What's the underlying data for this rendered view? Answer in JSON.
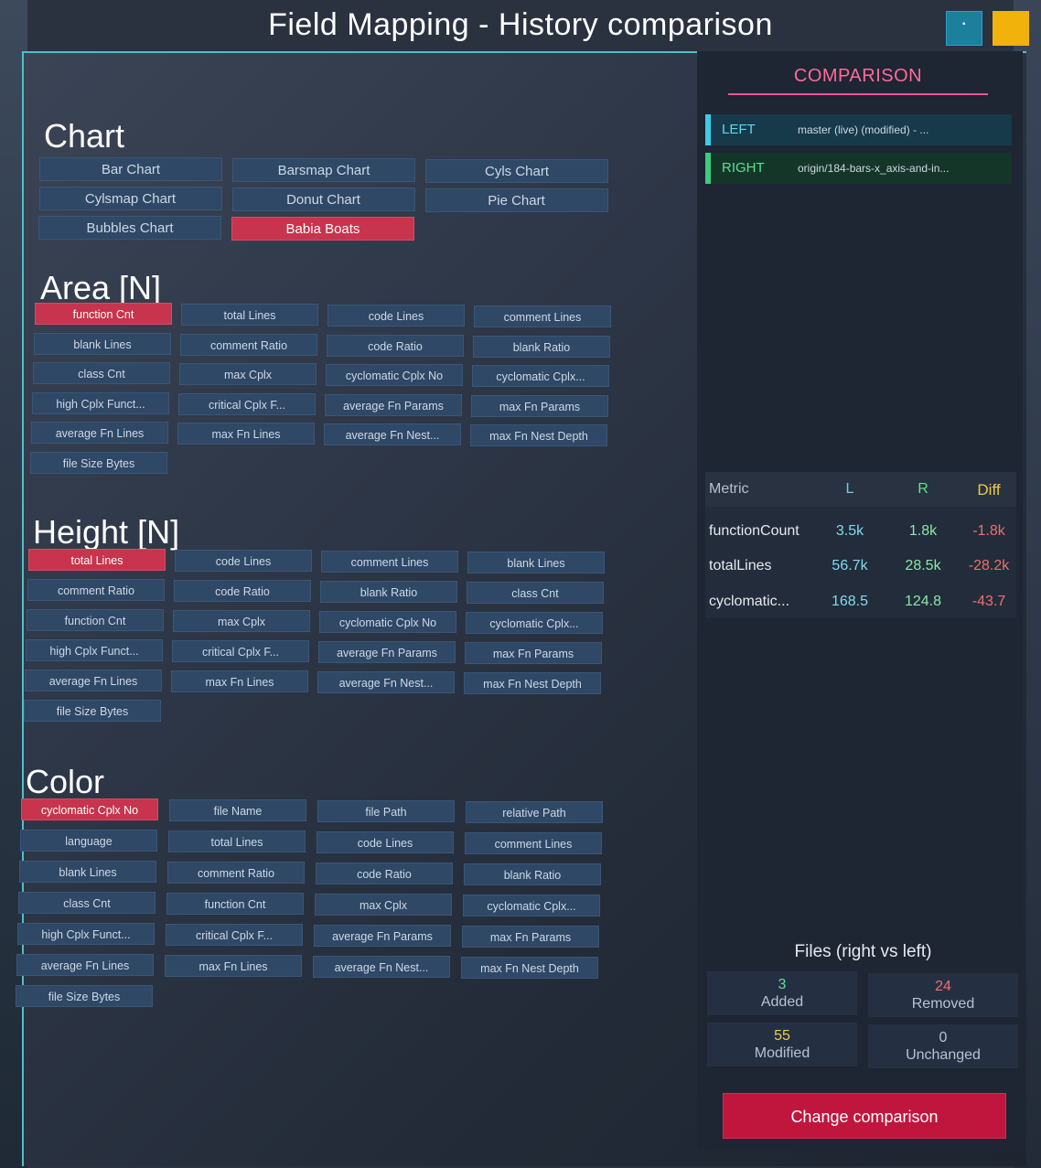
{
  "window": {
    "title": "Field Mapping - History comparison",
    "minimize_glyph": "▪"
  },
  "chart_section": {
    "title": "Chart",
    "buttons": [
      "Bar Chart",
      "Barsmap Chart",
      "Cyls Chart",
      "Cylsmap Chart",
      "Donut Chart",
      "Pie Chart",
      "Bubbles Chart",
      "Babia Boats"
    ],
    "selected": "Babia Boats"
  },
  "area_section": {
    "title": "Area [N]",
    "buttons": [
      "function Cnt",
      "total Lines",
      "code Lines",
      "comment Lines",
      "blank Lines",
      "comment Ratio",
      "code Ratio",
      "blank Ratio",
      "class Cnt",
      "max Cplx",
      "cyclomatic Cplx No",
      "cyclomatic Cplx...",
      "high Cplx Funct...",
      "critical Cplx F...",
      "average Fn Params",
      "max Fn Params",
      "average Fn Lines",
      "max Fn Lines",
      "average Fn Nest...",
      "max Fn Nest Depth",
      "file Size Bytes"
    ],
    "selected": "function Cnt"
  },
  "height_section": {
    "title": "Height [N]",
    "buttons": [
      "total Lines",
      "code Lines",
      "comment Lines",
      "blank Lines",
      "comment Ratio",
      "code Ratio",
      "blank Ratio",
      "class Cnt",
      "function Cnt",
      "max Cplx",
      "cyclomatic Cplx No",
      "cyclomatic Cplx...",
      "high Cplx Funct...",
      "critical Cplx F...",
      "average Fn Params",
      "max Fn Params",
      "average Fn Lines",
      "max Fn Lines",
      "average Fn Nest...",
      "max Fn Nest Depth",
      "file Size Bytes"
    ],
    "selected": "total Lines"
  },
  "color_section": {
    "title": "Color",
    "buttons": [
      "cyclomatic Cplx No",
      "file Name",
      "file Path",
      "relative Path",
      "language",
      "total Lines",
      "code Lines",
      "comment Lines",
      "blank Lines",
      "comment Ratio",
      "code Ratio",
      "blank Ratio",
      "class Cnt",
      "function Cnt",
      "max Cplx",
      "cyclomatic Cplx...",
      "high Cplx Funct...",
      "critical Cplx F...",
      "average Fn Params",
      "max Fn Params",
      "average Fn Lines",
      "max Fn Lines",
      "average Fn Nest...",
      "max Fn Nest Depth",
      "file Size Bytes"
    ],
    "selected": "cyclomatic Cplx No"
  },
  "comparison": {
    "title": "COMPARISON",
    "left": {
      "label": "LEFT",
      "value": "master (live) (modified) - ..."
    },
    "right": {
      "label": "RIGHT",
      "value": "origin/184-bars-x_axis-and-in..."
    }
  },
  "metrics_table": {
    "headers": {
      "metric": "Metric",
      "l": "L",
      "r": "R",
      "diff": "Diff"
    },
    "rows": [
      {
        "metric": "functionCount",
        "l": "3.5k",
        "r": "1.8k",
        "diff": "-1.8k"
      },
      {
        "metric": "totalLines",
        "l": "56.7k",
        "r": "28.5k",
        "diff": "-28.2k"
      },
      {
        "metric": "cyclomatic...",
        "l": "168.5",
        "r": "124.8",
        "diff": "-43.7"
      }
    ]
  },
  "files": {
    "title": "Files (right vs left)",
    "added": {
      "count": "3",
      "label": "Added",
      "color": "#5fe08f"
    },
    "removed": {
      "count": "24",
      "label": "Removed",
      "color": "#f06e6e"
    },
    "modified": {
      "count": "55",
      "label": "Modified",
      "color": "#f1c84b"
    },
    "unchanged": {
      "count": "0",
      "label": "Unchanged",
      "color": "#b8c2ce"
    }
  },
  "change_button": {
    "label": "Change comparison"
  },
  "colors": {
    "accent_pink": "#ff6b9a",
    "selected_red": "#c8344d",
    "button_blue": "#2f4866",
    "cta_red": "#c0163e"
  }
}
